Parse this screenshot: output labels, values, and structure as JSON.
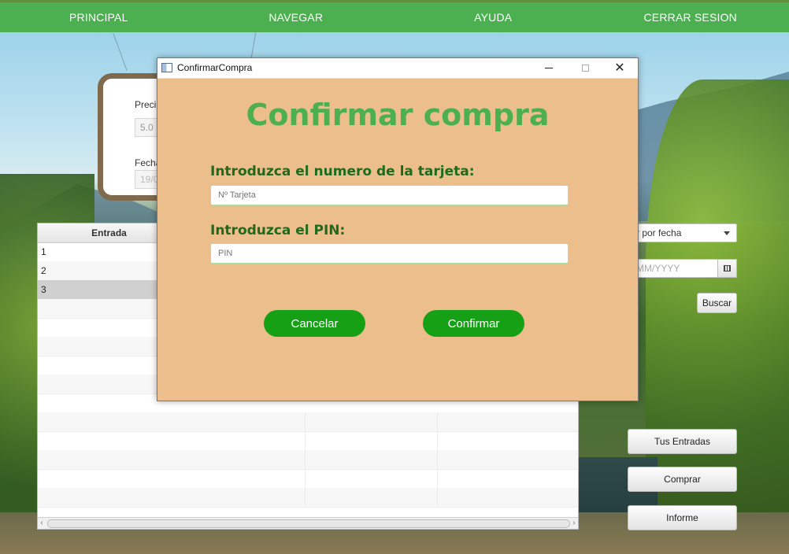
{
  "nav": {
    "items": [
      "PRINCIPAL",
      "NAVEGAR",
      "AYUDA",
      "CERRAR SESION"
    ]
  },
  "info_panel": {
    "price_label": "Precio",
    "price_value": "5.0",
    "date_label": "Fecha",
    "date_value": "19/0"
  },
  "table": {
    "header": "Entrada",
    "rows": [
      "1",
      "2",
      "3"
    ],
    "selected_row": 3,
    "scroll_left_glyph": "‹",
    "scroll_right_glyph": "›"
  },
  "controls": {
    "filter_select_value": "r por fecha",
    "date_placeholder": "MM/YYYY",
    "search_label": "Buscar",
    "my_tickets_label": "Tus Entradas",
    "buy_label": "Comprar",
    "report_label": "Informe"
  },
  "dialog": {
    "window_title": "ConfirmarCompra",
    "heading": "Confirmar compra",
    "card_label": "Introduzca el numero de la tarjeta:",
    "card_placeholder": "Nº Tarjeta",
    "pin_label": "Introduzca el PIN:",
    "pin_placeholder": "PIN",
    "cancel_label": "Cancelar",
    "confirm_label": "Confirmar",
    "close_glyph": "✕"
  },
  "colors": {
    "nav_green": "#4caf50",
    "dialog_bg": "#ebbe8c",
    "heading_green": "#4caf50",
    "label_green": "#1e6b1e",
    "button_green": "#15a015"
  }
}
